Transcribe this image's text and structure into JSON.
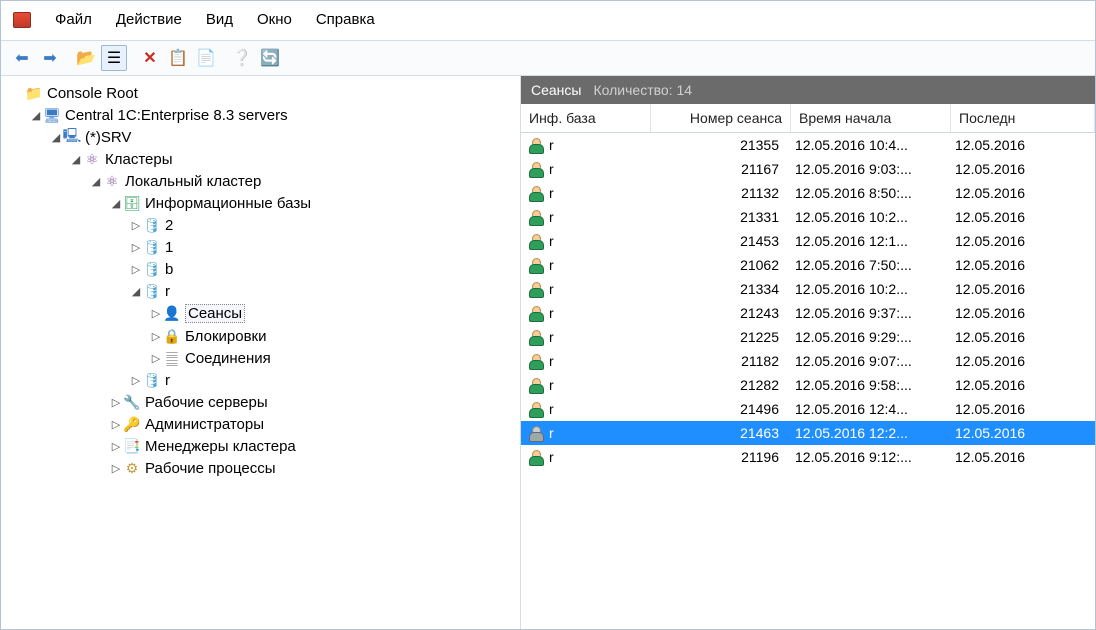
{
  "menu": {
    "file": "Файл",
    "action": "Действие",
    "view": "Вид",
    "window": "Окно",
    "help": "Справка"
  },
  "list": {
    "title": "Сеансы",
    "count_label": "Количество: 14",
    "col_inf": "Инф. база",
    "col_num": "Номер сеанса",
    "col_start": "Время начала",
    "col_last": "Последн"
  },
  "rows": [
    {
      "inf": "r",
      "num": "21355",
      "start": "12.05.2016 10:4...",
      "last": "12.05.2016",
      "sel": false
    },
    {
      "inf": "r",
      "num": "21167",
      "start": "12.05.2016 9:03:...",
      "last": "12.05.2016",
      "sel": false
    },
    {
      "inf": "r",
      "num": "21132",
      "start": "12.05.2016 8:50:...",
      "last": "12.05.2016",
      "sel": false
    },
    {
      "inf": "r",
      "num": "21331",
      "start": "12.05.2016 10:2...",
      "last": "12.05.2016",
      "sel": false
    },
    {
      "inf": "r",
      "num": "21453",
      "start": "12.05.2016 12:1...",
      "last": "12.05.2016",
      "sel": false
    },
    {
      "inf": "r",
      "num": "21062",
      "start": "12.05.2016 7:50:...",
      "last": "12.05.2016",
      "sel": false
    },
    {
      "inf": "r",
      "num": "21334",
      "start": "12.05.2016 10:2...",
      "last": "12.05.2016",
      "sel": false
    },
    {
      "inf": "r",
      "num": "21243",
      "start": "12.05.2016 9:37:...",
      "last": "12.05.2016",
      "sel": false
    },
    {
      "inf": "r",
      "num": "21225",
      "start": "12.05.2016 9:29:...",
      "last": "12.05.2016",
      "sel": false
    },
    {
      "inf": "r",
      "num": "21182",
      "start": "12.05.2016 9:07:...",
      "last": "12.05.2016",
      "sel": false
    },
    {
      "inf": "r",
      "num": "21282",
      "start": "12.05.2016 9:58:...",
      "last": "12.05.2016",
      "sel": false
    },
    {
      "inf": "r",
      "num": "21496",
      "start": "12.05.2016 12:4...",
      "last": "12.05.2016",
      "sel": false
    },
    {
      "inf": "r",
      "num": "21463",
      "start": "12.05.2016 12:2...",
      "last": "12.05.2016",
      "sel": true
    },
    {
      "inf": "r",
      "num": "21196",
      "start": "12.05.2016 9:12:...",
      "last": "12.05.2016",
      "sel": false
    }
  ],
  "tree": {
    "root": "Console Root",
    "central": "Central 1C:Enterprise 8.3 servers",
    "srv": "(*)SRV",
    "clusters": "Кластеры",
    "localcluster": "Локальный кластер",
    "infobases": "Информационные базы",
    "ib_2": "2",
    "ib_1": "1",
    "ib_b": "b",
    "ib_r": "r",
    "sessions": "Сеансы",
    "locks": "Блокировки",
    "connections": "Соединения",
    "ib_r2": "r",
    "workservers": "Рабочие серверы",
    "admins": "Администраторы",
    "clustermgrs": "Менеджеры кластера",
    "workprocs": "Рабочие процессы"
  }
}
